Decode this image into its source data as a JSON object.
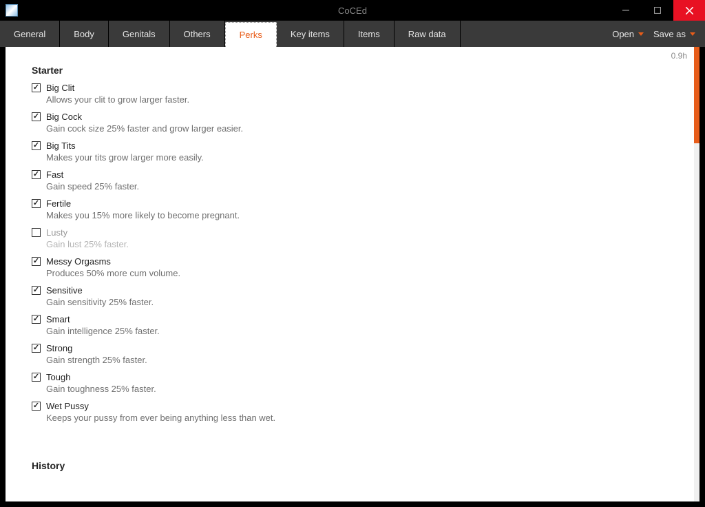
{
  "app_title": "CoCEd",
  "time_indicator": "0.9h",
  "tabs": [
    {
      "label": "General"
    },
    {
      "label": "Body"
    },
    {
      "label": "Genitals"
    },
    {
      "label": "Others"
    },
    {
      "label": "Perks",
      "active": true
    },
    {
      "label": "Key items"
    },
    {
      "label": "Items"
    },
    {
      "label": "Raw data"
    }
  ],
  "actions": {
    "open": "Open",
    "save_as": "Save as"
  },
  "sections": [
    {
      "title": "Starter",
      "perks": [
        {
          "checked": true,
          "label": "Big Clit",
          "desc": "Allows your clit to grow larger faster."
        },
        {
          "checked": true,
          "label": "Big Cock",
          "desc": "Gain cock size 25% faster and grow larger easier."
        },
        {
          "checked": true,
          "label": "Big Tits",
          "desc": "Makes your tits grow larger more easily."
        },
        {
          "checked": true,
          "label": "Fast",
          "desc": "Gain speed 25% faster."
        },
        {
          "checked": true,
          "label": "Fertile",
          "desc": "Makes you 15% more likely to become pregnant."
        },
        {
          "checked": false,
          "label": "Lusty",
          "desc": "Gain lust 25% faster.",
          "disabled": true
        },
        {
          "checked": true,
          "label": "Messy Orgasms",
          "desc": "Produces 50% more cum volume."
        },
        {
          "checked": true,
          "label": "Sensitive",
          "desc": "Gain sensitivity 25% faster."
        },
        {
          "checked": true,
          "label": "Smart",
          "desc": "Gain intelligence 25% faster."
        },
        {
          "checked": true,
          "label": "Strong",
          "desc": "Gain strength 25% faster."
        },
        {
          "checked": true,
          "label": "Tough",
          "desc": "Gain toughness 25% faster."
        },
        {
          "checked": true,
          "label": "Wet Pussy",
          "desc": "Keeps your pussy from ever being anything less than wet."
        }
      ]
    },
    {
      "title": "History",
      "perks": []
    }
  ]
}
